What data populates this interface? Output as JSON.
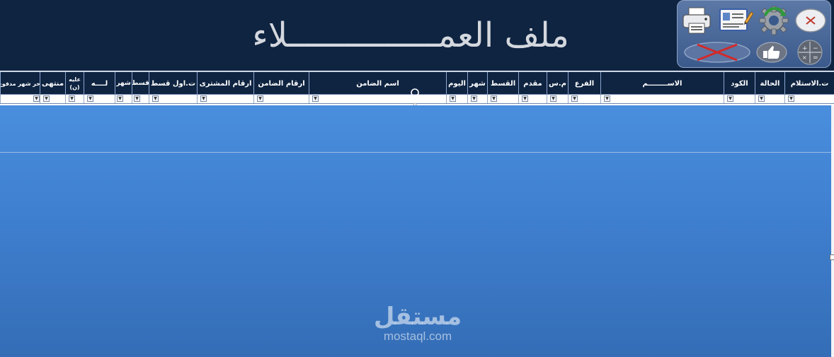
{
  "banner": {
    "title": "ملف العمـــــــــــــــلاء"
  },
  "toolbar": {
    "buttons": [
      {
        "name": "print-icon",
        "label": ""
      },
      {
        "name": "edit-card-icon",
        "label": ""
      },
      {
        "name": "refresh-gear-icon",
        "label": ""
      },
      {
        "name": "close-icon",
        "label": ""
      },
      {
        "name": "delete-x-icon",
        "label": ""
      },
      {
        "name": "thumbs-up-icon",
        "label": ""
      },
      {
        "name": "calculator-icon",
        "label": ""
      }
    ]
  },
  "columns": [
    {
      "key": "receipt_date",
      "label": "ت.الاستلام"
    },
    {
      "key": "status",
      "label": "الحالة"
    },
    {
      "key": "code",
      "label": "الكود"
    },
    {
      "key": "name",
      "label": "الاســــــــم"
    },
    {
      "key": "branch",
      "label": "الفرع"
    },
    {
      "key": "price",
      "label": "م.س"
    },
    {
      "key": "advance",
      "label": "مقدم"
    },
    {
      "key": "installment",
      "label": "القسط"
    },
    {
      "key": "month",
      "label": "شهر"
    },
    {
      "key": "day",
      "label": "اليوم"
    },
    {
      "key": "guarantor_name",
      "label": "اسم الضامن"
    },
    {
      "key": "guarantor_phones",
      "label": "ارقام الضامن"
    },
    {
      "key": "buyer_phones",
      "label": "ارقام المشترى"
    },
    {
      "key": "first_installment_date",
      "label": "ت.اول قسط"
    },
    {
      "key": "installment2",
      "label": "قسط"
    },
    {
      "key": "month2",
      "label": "شهر"
    },
    {
      "key": "credit",
      "label": "لــــه"
    },
    {
      "key": "debit",
      "label": "عليه (ن)"
    },
    {
      "key": "ended",
      "label": "منتهى"
    },
    {
      "key": "last_month",
      "label": "اخر شهر مدفوع"
    }
  ],
  "filter": {
    "arrow": "▼"
  },
  "watermark": {
    "arabic": "مستقل",
    "latin": "mostaql.com"
  },
  "colors": {
    "banner": "#0f2441",
    "panel": "#3f7fcf",
    "title": "#d4d8de"
  }
}
